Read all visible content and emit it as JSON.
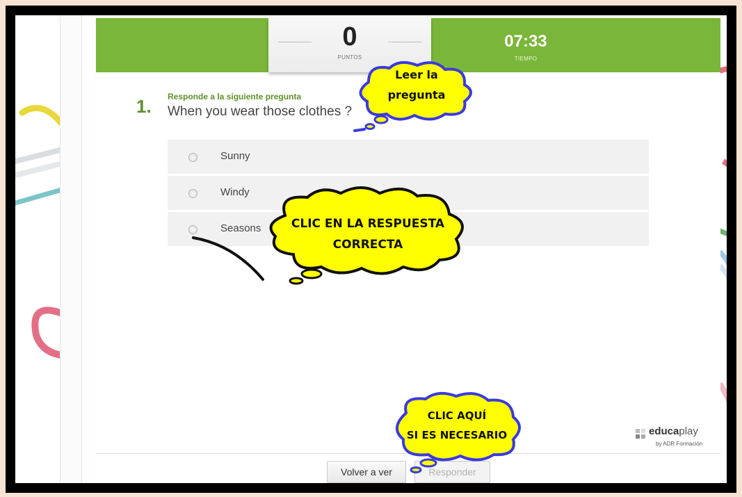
{
  "quiz": {
    "score_value": "0",
    "score_label": "PUNTOS",
    "time_value": "07:33",
    "time_label": "TIEMPO",
    "question_number": "1.",
    "instruction": "Responde a la siguiente pregunta",
    "question_text": "When you wear those clothes ?",
    "options": [
      {
        "label": "Sunny",
        "selected": false
      },
      {
        "label": "Windy",
        "selected": false
      },
      {
        "label": "Seasons",
        "selected": false
      }
    ]
  },
  "footer": {
    "back_label": "Volver a ver",
    "answer_label": "Responder"
  },
  "brand": {
    "name_bold": "educa",
    "name_light": "play",
    "sub": "by ADR Formación"
  },
  "callouts": {
    "read_line1": "Leer la",
    "read_line2": "pregunta",
    "click_answer_line1": "CLIC EN LA RESPUESTA",
    "click_answer_line2": "CORRECTA",
    "click_here_line1": "CLIC AQUÍ",
    "click_here_line2": "SI ES NECESARIO"
  },
  "colors": {
    "accent_green": "#7ab639",
    "callout_fill": "#ffff00",
    "callout_stroke": "#3a3ae0"
  }
}
